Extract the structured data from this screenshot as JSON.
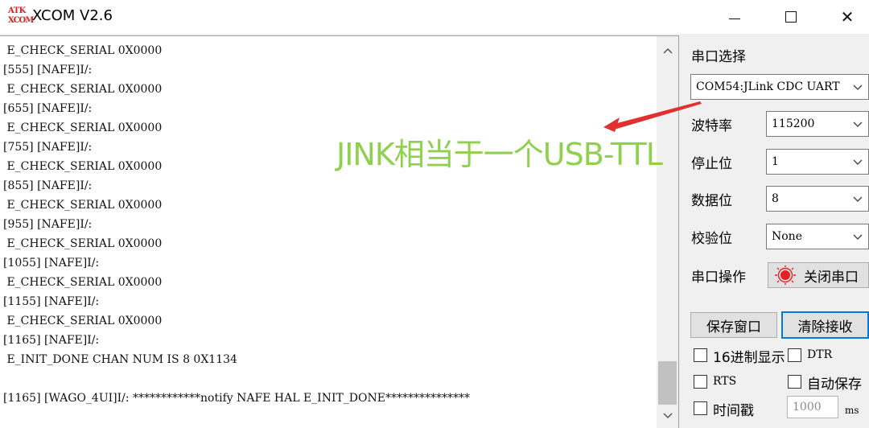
{
  "window": {
    "logo_top": "ATK",
    "logo_bottom": "XCOM",
    "title": "XCOM V2.6",
    "minimize_glyph": "—",
    "close_glyph": "✕"
  },
  "receive": {
    "lines": [
      " E_CHECK_SERIAL 0X0000",
      "[555] [NAFE]I/:",
      " E_CHECK_SERIAL 0X0000",
      "[655] [NAFE]I/:",
      " E_CHECK_SERIAL 0X0000",
      "[755] [NAFE]I/:",
      " E_CHECK_SERIAL 0X0000",
      "[855] [NAFE]I/:",
      " E_CHECK_SERIAL 0X0000",
      "[955] [NAFE]I/:",
      " E_CHECK_SERIAL 0X0000",
      "[1055] [NAFE]I/:",
      " E_CHECK_SERIAL 0X0000",
      "[1155] [NAFE]I/:",
      " E_CHECK_SERIAL 0X0000",
      "[1165] [NAFE]I/:",
      " E_INIT_DONE CHAN NUM IS 8 0X1134",
      "",
      "[1165] [WAGO_4UI]I/: ************notify NAFE HAL E_INIT_DONE***************"
    ]
  },
  "panel": {
    "port_select_label": "串口选择",
    "port_value": "COM54:JLink CDC UART",
    "baud_label": "波特率",
    "baud_value": "115200",
    "stopbits_label": "停止位",
    "stopbits_value": "1",
    "databits_label": "数据位",
    "databits_value": "8",
    "parity_label": "校验位",
    "parity_value": "None",
    "port_op_label": "串口操作",
    "close_port_button": "关闭串口",
    "save_window_button": "保存窗口",
    "clear_recv_button": "清除接收",
    "hex_display_label": "16进制显示",
    "dtr_label": "DTR",
    "rts_label": "RTS",
    "auto_save_label": "自动保存",
    "timestamp_label": "时间戳",
    "timestamp_ms_value": "1000",
    "ms_unit": "ms"
  },
  "annotation": {
    "text": "JINK相当于一个USB-TTL",
    "color": "#8fd14f",
    "arrow_color": "#e03030"
  }
}
